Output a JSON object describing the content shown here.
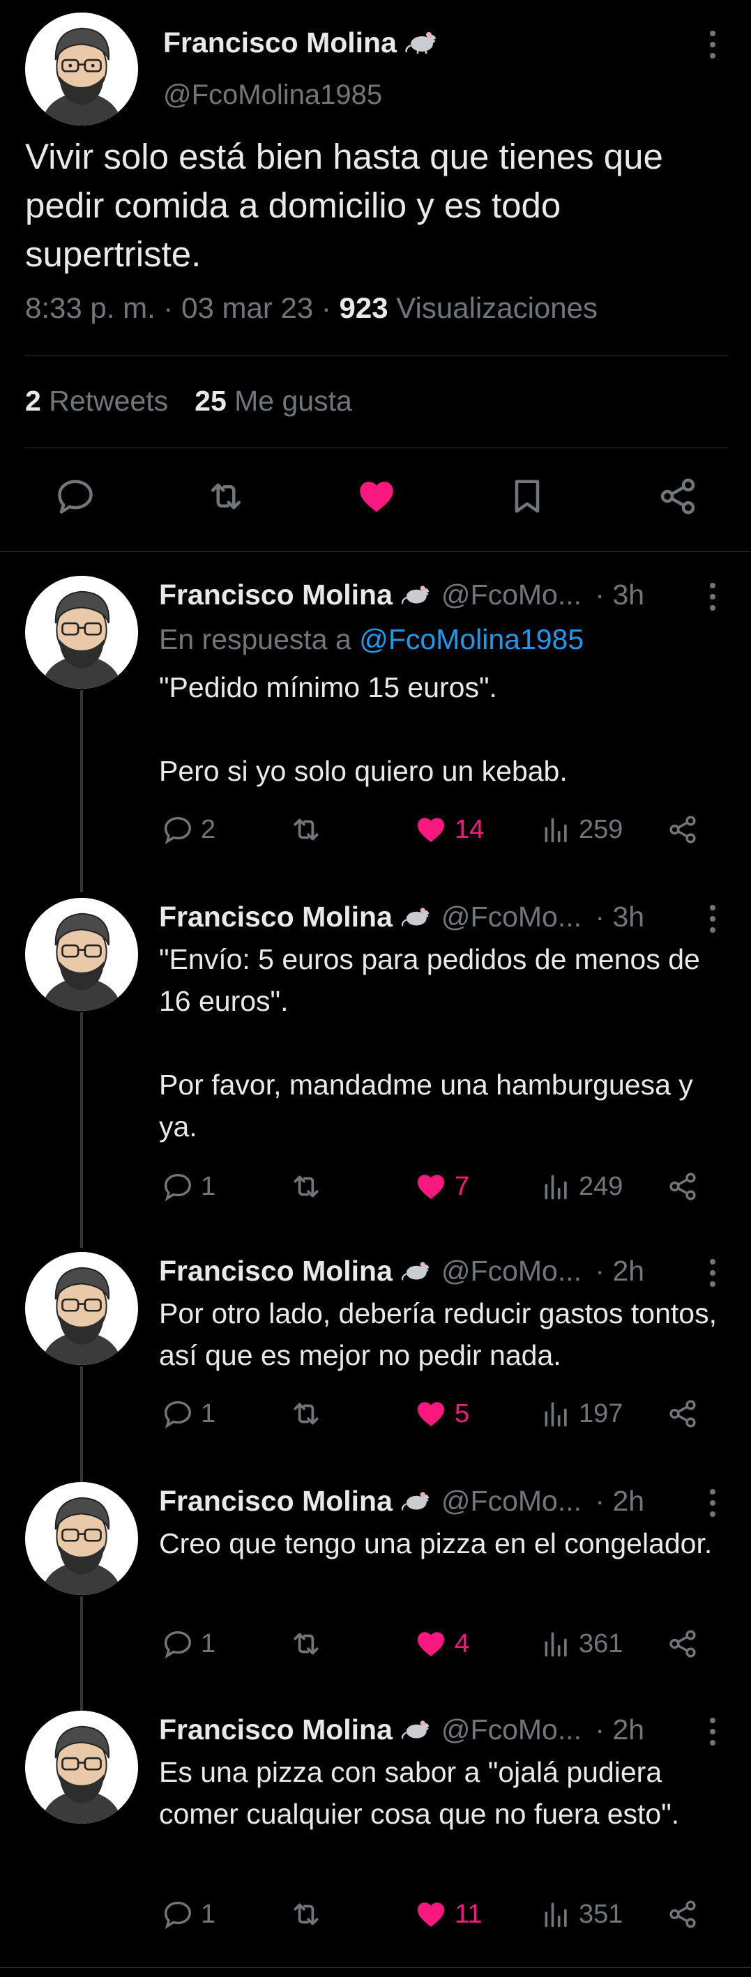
{
  "colors": {
    "background": "#000000",
    "text": "#e7e9ea",
    "muted": "#71767b",
    "link": "#1d9bf0",
    "like": "#f91880",
    "divider": "#2f3336"
  },
  "main_tweet": {
    "author_name": "Francisco Molina",
    "author_badge_icon": "mouse-icon",
    "handle": "@FcoMolina1985",
    "text": "Vivir solo está bien hasta que tienes que pedir comida a domicilio y es todo supertriste.",
    "time": "8:33 p. m.",
    "date": "03 mar 23",
    "views_count": "923",
    "views_label": "Visualizaciones",
    "retweets_count": "2",
    "retweets_label": "Retweets",
    "likes_count": "25",
    "likes_label": "Me gusta",
    "actions": [
      "reply-icon",
      "retweet-icon",
      "like-icon",
      "bookmark-icon",
      "share-icon"
    ]
  },
  "replies": [
    {
      "author_name": "Francisco Molina",
      "handle": "@FcoMo...",
      "time": "3h",
      "in_reply_prefix": "En respuesta a",
      "in_reply_to": "@FcoMolina1985",
      "text": "\"Pedido mínimo 15 euros\".\n\nPero si yo solo quiero un kebab.",
      "replies": "2",
      "retweets": "",
      "likes": "14",
      "views": "259"
    },
    {
      "author_name": "Francisco Molina",
      "handle": "@FcoMo...",
      "time": "3h",
      "text": "\"Envío: 5 euros para pedidos de menos de 16 euros\".\n\nPor favor, mandadme una hamburguesa y ya.",
      "replies": "1",
      "retweets": "",
      "likes": "7",
      "views": "249"
    },
    {
      "author_name": "Francisco Molina",
      "handle": "@FcoMo...",
      "time": "2h",
      "text": "Por otro lado, debería reducir gastos tontos, así que es mejor no pedir nada.",
      "replies": "1",
      "retweets": "",
      "likes": "5",
      "views": "197"
    },
    {
      "author_name": "Francisco Molina",
      "handle": "@FcoMo...",
      "time": "2h",
      "text": "Creo que tengo una pizza en el congelador.",
      "replies": "1",
      "retweets": "",
      "likes": "4",
      "views": "361"
    },
    {
      "author_name": "Francisco Molina",
      "handle": "@FcoMo...",
      "time": "2h",
      "text": "Es una pizza con sabor a \"ojalá pudiera comer cualquier cosa que no fuera esto\".",
      "replies": "1",
      "retweets": "",
      "likes": "11",
      "views": "351"
    }
  ]
}
